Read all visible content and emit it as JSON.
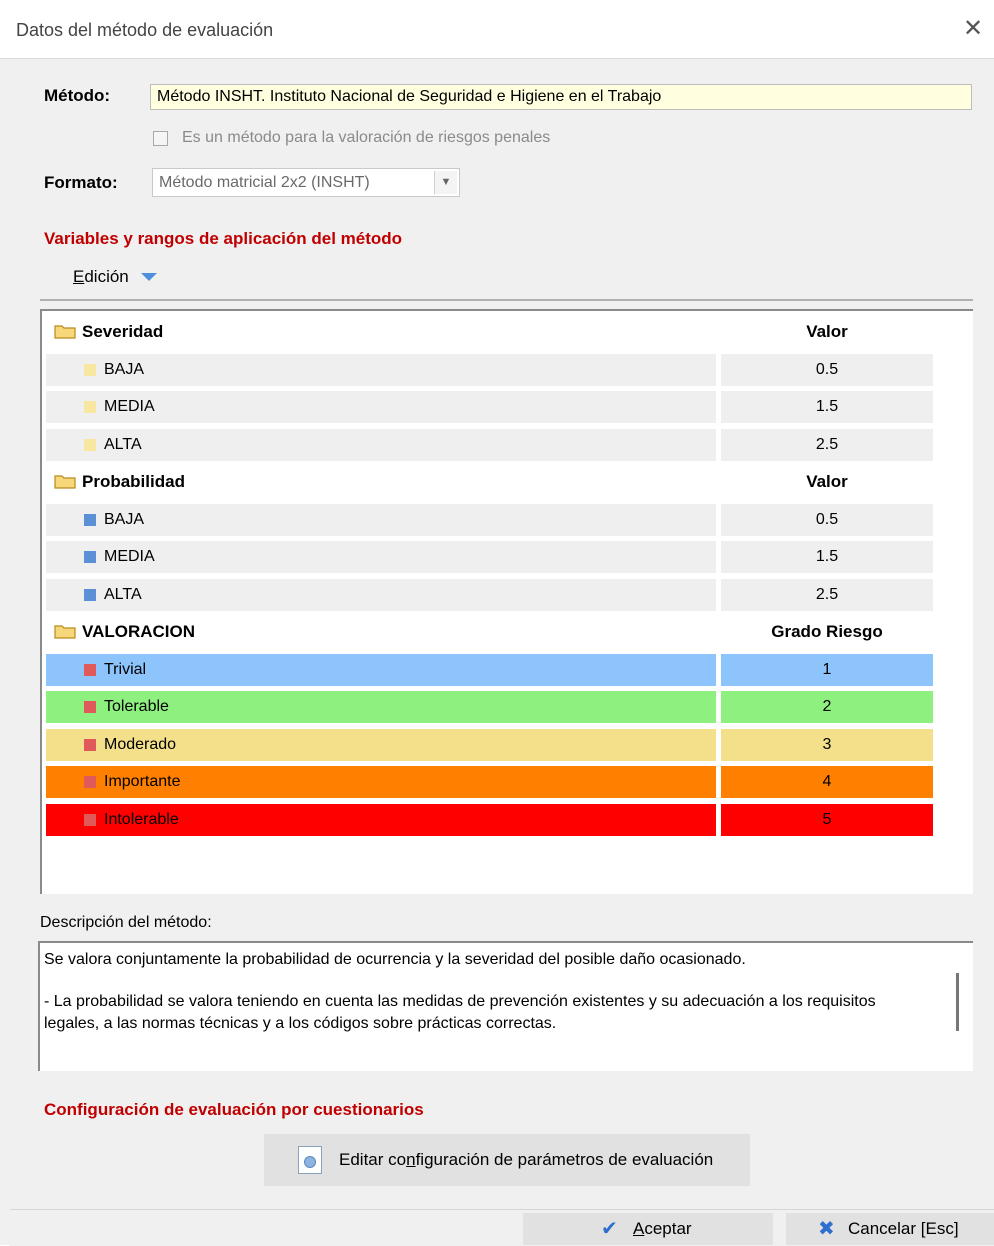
{
  "window": {
    "title": "Datos del método de evaluación"
  },
  "form": {
    "metodo_label": "Método:",
    "metodo_value": "Método INSHT. Instituto Nacional de Seguridad e Higiene en el Trabajo",
    "checkbox_label": "Es un método para la valoración de riesgos penales",
    "checkbox_checked": false,
    "formato_label": "Formato:",
    "formato_value": "Método matricial 2x2 (INSHT)"
  },
  "variables": {
    "section_title": "Variables y rangos de aplicación del método",
    "edicion_prefix": "E",
    "edicion_rest": "dición",
    "groups": [
      {
        "name": "Severidad",
        "value_header": "Valor",
        "item_color": "#f7e7a0",
        "items": [
          {
            "label": "BAJA",
            "value": "0.5"
          },
          {
            "label": "MEDIA",
            "value": "1.5"
          },
          {
            "label": "ALTA",
            "value": "2.5"
          }
        ]
      },
      {
        "name": "Probabilidad",
        "value_header": "Valor",
        "item_color": "#5b8fd6",
        "items": [
          {
            "label": "BAJA",
            "value": "0.5"
          },
          {
            "label": "MEDIA",
            "value": "1.5"
          },
          {
            "label": "ALTA",
            "value": "2.5"
          }
        ]
      },
      {
        "name": "VALORACION",
        "value_header": "Grado Riesgo",
        "item_color": "#e05a5a",
        "items": [
          {
            "label": "Trivial",
            "value": "1",
            "bg": "#8cc4fb"
          },
          {
            "label": "Tolerable",
            "value": "2",
            "bg": "#8df07f"
          },
          {
            "label": "Moderado",
            "value": "3",
            "bg": "#f4e08a"
          },
          {
            "label": "Importante",
            "value": "4",
            "bg": "#ff8000"
          },
          {
            "label": "Intolerable",
            "value": "5",
            "bg": "#ff0000"
          }
        ]
      }
    ]
  },
  "descripcion": {
    "label": "Descripción del método:",
    "p1": "Se valora conjuntamente la probabilidad de ocurrencia y la severidad del posible daño ocasionado.",
    "p2": "- La probabilidad se valora teniendo en cuenta las medidas de prevención existentes y su adecuación a los requisitos legales, a las normas técnicas y a los códigos sobre prácticas correctas."
  },
  "cuestionarios": {
    "section_title": "Configuración de evaluación por cuestionarios",
    "button_pre": "Editar co",
    "button_ul": "n",
    "button_post": "figuración de parámetros de evaluación"
  },
  "footer": {
    "accept_ul": "A",
    "accept_rest": "ceptar",
    "cancel_label": "Cancelar [Esc]"
  },
  "icons": {
    "close": "close-icon",
    "check": "check-icon",
    "cancel": "cross-icon",
    "folder": "folder-icon",
    "settings": "settings-document-icon"
  }
}
